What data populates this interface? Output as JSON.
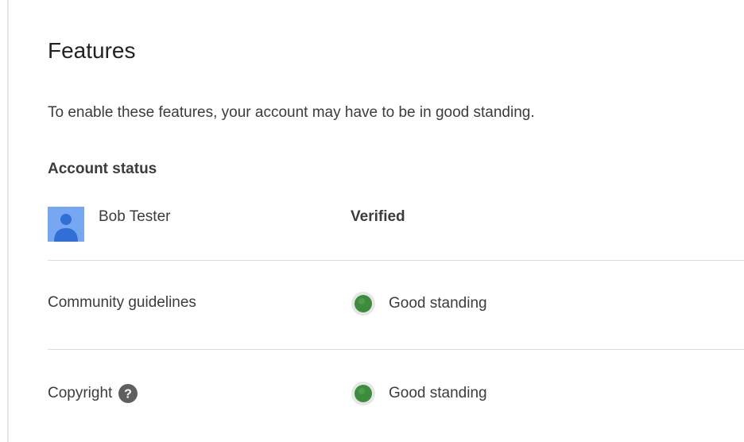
{
  "panel": {
    "title": "Features",
    "description": "To enable these features, your account may have to be in good standing."
  },
  "account_status": {
    "heading": "Account status",
    "user_name": "Bob Tester",
    "verification": "Verified"
  },
  "rows": [
    {
      "label": "Community guidelines",
      "status": "Good standing",
      "status_color": "#3d8b3d"
    },
    {
      "label": "Copyright",
      "status": "Good standing",
      "status_color": "#3d8b3d",
      "help_icon": "help-icon"
    }
  ],
  "colors": {
    "avatar_background": "#78a7f2",
    "avatar_figure": "#2f6fd6",
    "good_standing": "#3d8b3d"
  }
}
